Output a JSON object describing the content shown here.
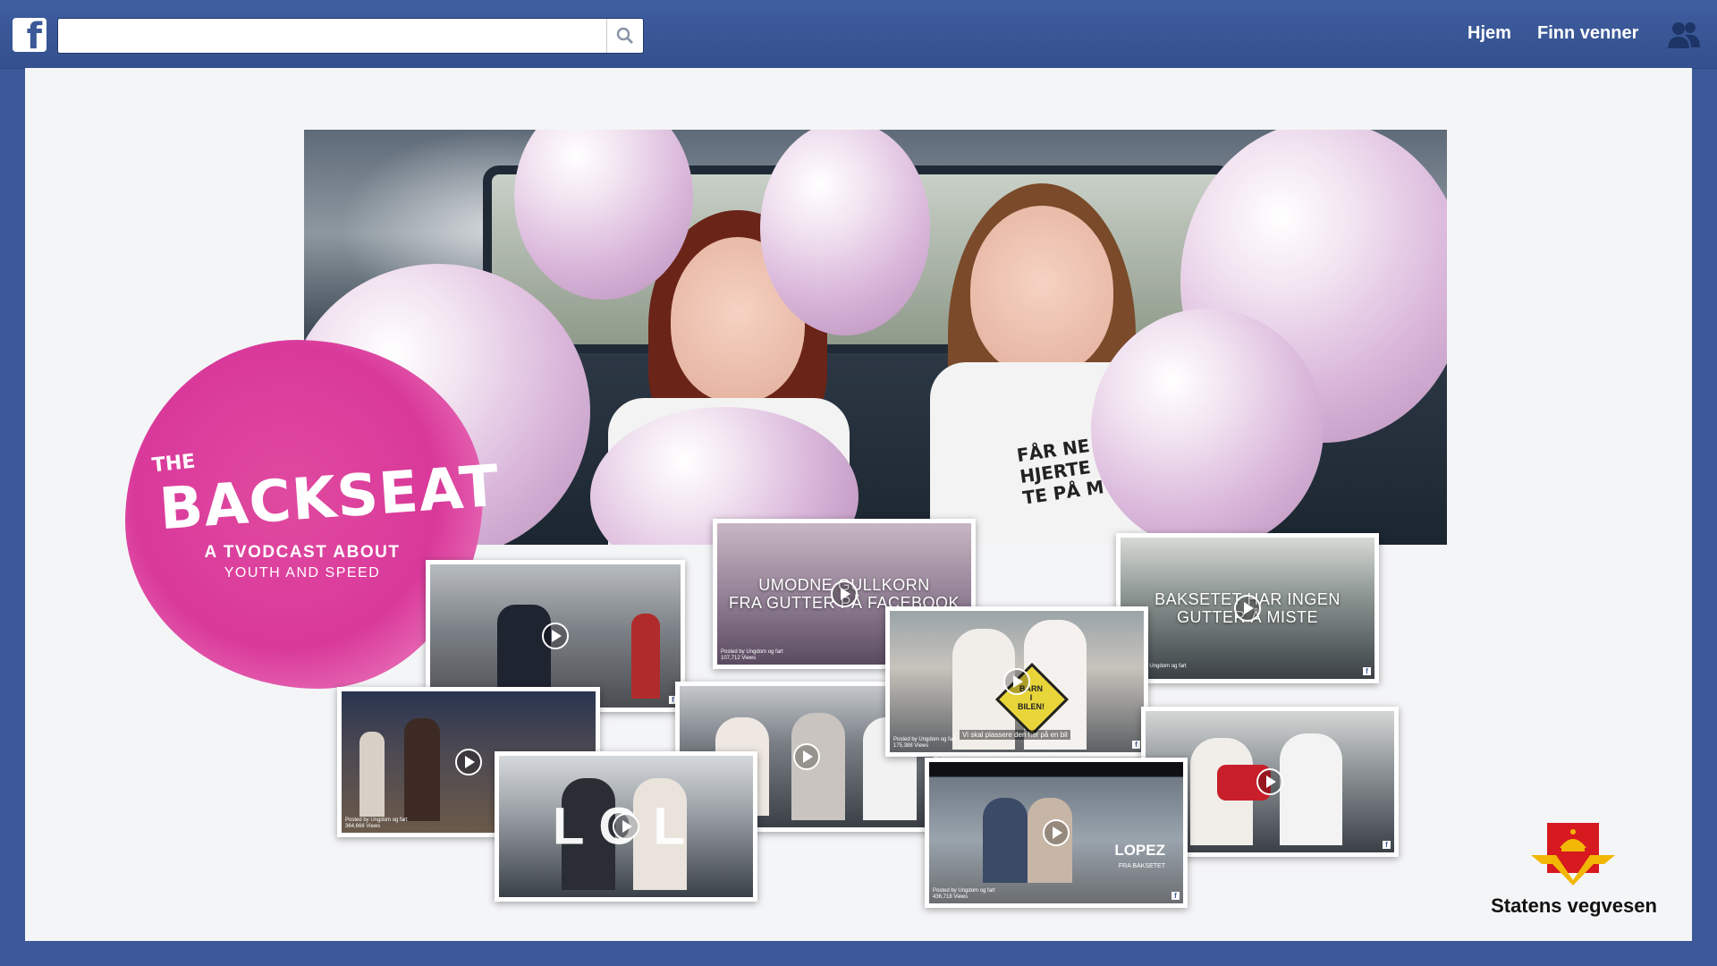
{
  "header": {
    "logo_letter": "f",
    "search": {
      "placeholder": "",
      "value": ""
    },
    "nav": {
      "home": "Hjem",
      "find_friends": "Finn venner"
    }
  },
  "campaign": {
    "title_prefix": "THE",
    "title": "BACKSEAT",
    "subtitle": "A TVODCAST ABOUT",
    "subtitle2": "YOUTH AND SPEED",
    "hero_shirt_text": "FÅR NE\nHJERTE S\nTE PÅ M"
  },
  "videos": [
    {
      "id": "v1",
      "overlay": "",
      "posted": ""
    },
    {
      "id": "v2",
      "overlay": "UMODNE GULLKORN\nFRA GUTTER PÅ FACEBOOK",
      "posted": "Posted by Ungdom og fart\n107,712 Views"
    },
    {
      "id": "v3",
      "overlay": "BAKSETET HAR INGEN\nGUTTER Å MISTE",
      "posted": "Posted by Ungdom og fart\nViews"
    },
    {
      "id": "v4",
      "overlay": "",
      "posted": "Posted by Ungdom og fart\n364,666 Views"
    },
    {
      "id": "v5",
      "overlay": "",
      "posted": ""
    },
    {
      "id": "v6",
      "overlay": "",
      "sign": "BARN\nI\nBILEN!",
      "caption": "Vi skal plassere den her på en bil",
      "posted": "Posted by Ungdom og fart\n175,388 Views"
    },
    {
      "id": "v7",
      "overlay": "",
      "big_word": "LOL",
      "posted": ""
    },
    {
      "id": "v8",
      "overlay": "",
      "posted": ""
    },
    {
      "id": "v9",
      "overlay": "",
      "lopez": "LOPEZ",
      "lopez_sub": "FRA BAKSETET",
      "posted": "Posted by Ungdom og fart\n436,718 Views"
    }
  ],
  "brand": {
    "name": "Statens vegvesen"
  },
  "colors": {
    "facebook_blue": "#3b5998",
    "splash_pink": "#d9399a",
    "panel_bg": "#f4f5f7"
  }
}
